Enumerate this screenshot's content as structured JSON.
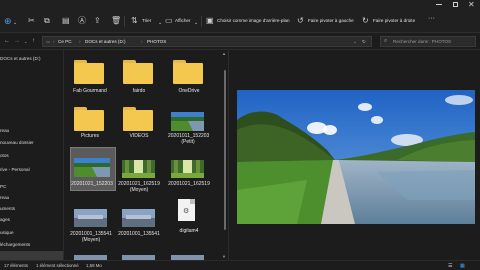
{
  "command_bar": {
    "sort_label": "Trier",
    "view_label": "Afficher",
    "set_background_label": "Choisir comme image d'arrière-plan",
    "rotate_left_label": "Faire pivoter à gauche",
    "rotate_right_label": "Faire pivoter à droite",
    "more_label": "···"
  },
  "address": {
    "crumbs": [
      "Ce PC",
      "DOCs et autres (D:)",
      "PHOTOS"
    ],
    "search_placeholder": "Rechercher dans : PHOTOS"
  },
  "sidebar": {
    "items": [
      "DOCs et autres (D:)",
      "",
      "reau",
      "nouveau dossier",
      "otos",
      "rive - Personal",
      "PC",
      "reau",
      "uments",
      "ages",
      "usique",
      "léchargements",
      "ANSFERT-PC",
      "ANSFERT-PC",
      "déos",
      "(C:)",
      "OCs et autres (D:)"
    ]
  },
  "files": [
    {
      "name": "Fab Gourmand",
      "kind": "folder"
    },
    {
      "name": "fairdo",
      "kind": "folder"
    },
    {
      "name": "OneDrive",
      "kind": "folder"
    },
    {
      "name": "Pictures",
      "kind": "folder"
    },
    {
      "name": "VIDEOS",
      "kind": "folder"
    },
    {
      "name": "20201011_152203 (Petit)",
      "kind": "image-canal"
    },
    {
      "name": "20201021_152203",
      "kind": "image-canal",
      "selected": true
    },
    {
      "name": "20201021_162519 (Moyen)",
      "kind": "image-forest"
    },
    {
      "name": "20201021_162519",
      "kind": "image-forest"
    },
    {
      "name": "20201001_135541 (Moyen)",
      "kind": "image-blurry"
    },
    {
      "name": "20201001_135541",
      "kind": "image-blurry"
    },
    {
      "name": "digitam4",
      "kind": "file"
    }
  ],
  "status": {
    "count": "17 éléments",
    "selection": "1 élément sélectionné",
    "size": "1,58 Mo"
  },
  "colors": {
    "accent": "#4c9be8",
    "folder": "#f4c84f",
    "background": "#1c1c1c"
  }
}
